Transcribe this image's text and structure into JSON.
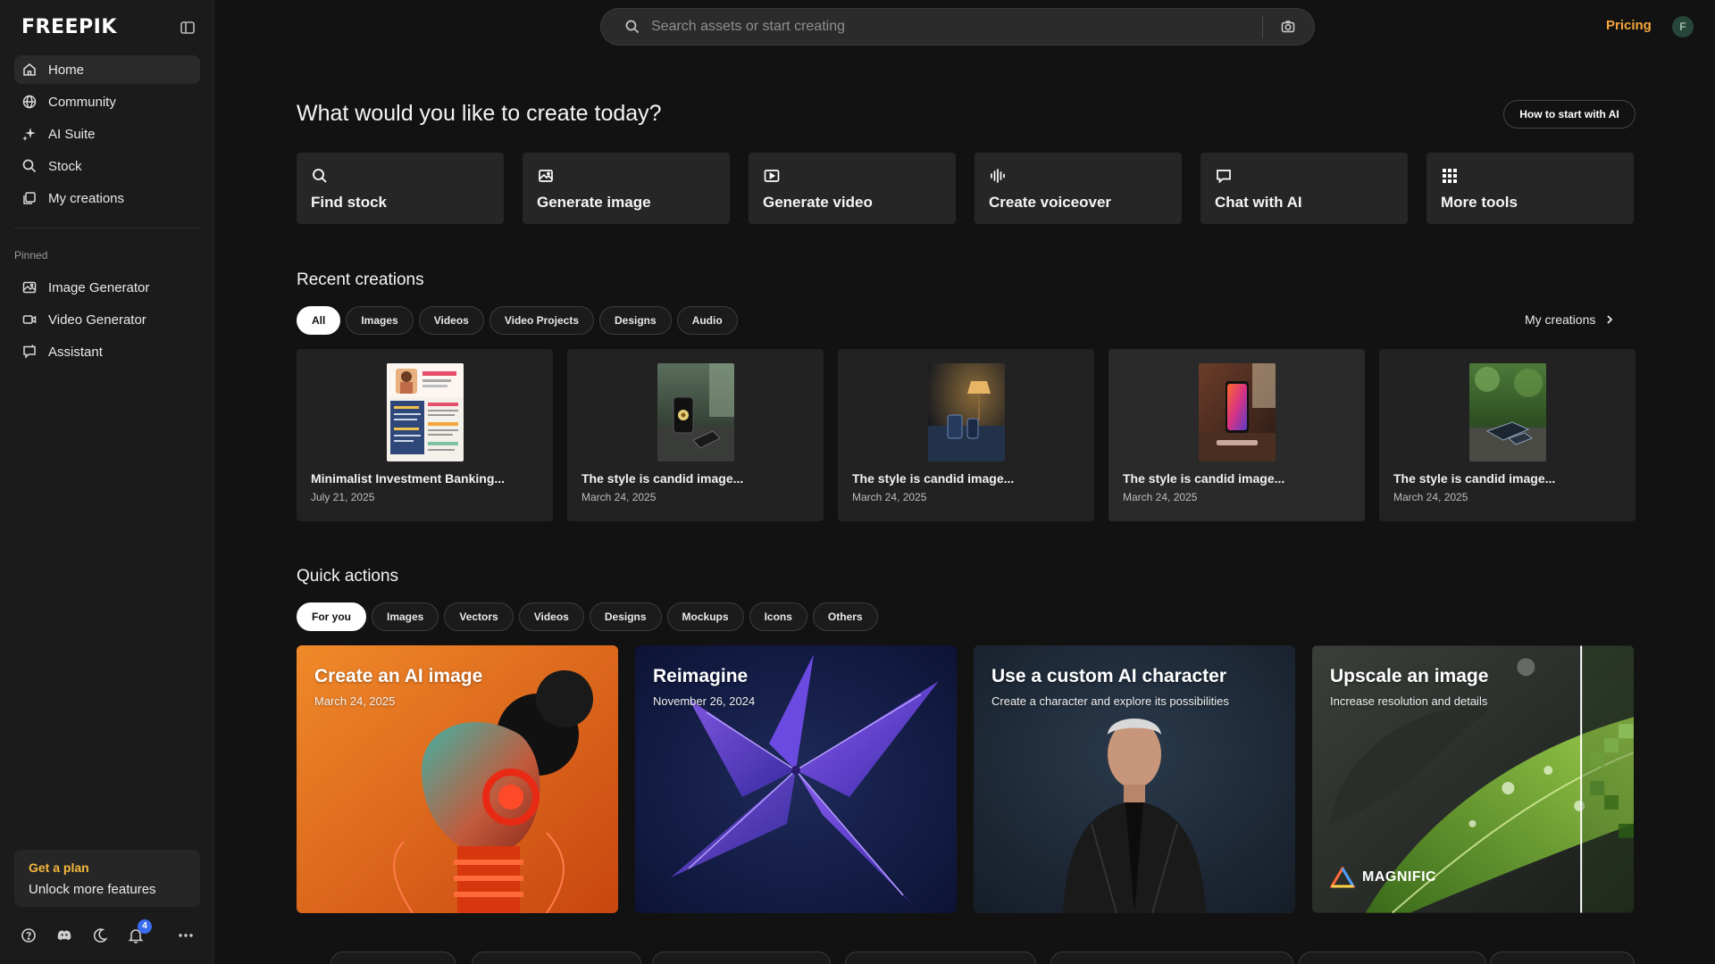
{
  "brand": {
    "logo": "FREEPIK"
  },
  "sidebar": {
    "nav": [
      {
        "label": "Home",
        "icon": "home-icon",
        "active": true
      },
      {
        "label": "Community",
        "icon": "globe-icon"
      },
      {
        "label": "AI Suite",
        "icon": "sparkle-icon"
      },
      {
        "label": "Stock",
        "icon": "search-icon"
      },
      {
        "label": "My creations",
        "icon": "creations-icon"
      }
    ],
    "pinned_label": "Pinned",
    "pinned": [
      {
        "label": "Image Generator",
        "icon": "image-generator-icon"
      },
      {
        "label": "Video Generator",
        "icon": "video-generator-icon"
      },
      {
        "label": "Assistant",
        "icon": "assistant-icon"
      }
    ],
    "plan": {
      "title": "Get a plan",
      "subtitle": "Unlock more features"
    },
    "notifications_count": "4"
  },
  "topbar": {
    "search_placeholder": "Search assets or start creating",
    "pricing": "Pricing",
    "avatar_initial": "F"
  },
  "main": {
    "heading": "What would you like to create today?",
    "how_to": "How to start with AI",
    "tools": [
      {
        "label": "Find stock",
        "icon": "search-icon"
      },
      {
        "label": "Generate image",
        "icon": "image-icon"
      },
      {
        "label": "Generate video",
        "icon": "video-icon"
      },
      {
        "label": "Create voiceover",
        "icon": "waveform-icon"
      },
      {
        "label": "Chat with AI",
        "icon": "chat-icon"
      },
      {
        "label": "More tools",
        "icon": "grid-icon"
      }
    ],
    "recent": {
      "title": "Recent creations",
      "filters": [
        "All",
        "Images",
        "Videos",
        "Video Projects",
        "Designs",
        "Audio"
      ],
      "active_filter": "All",
      "my_creations_link": "My creations",
      "items": [
        {
          "title": "Minimalist Investment Banking...",
          "date": "July 21, 2025"
        },
        {
          "title": "The style is candid image...",
          "date": "March 24, 2025"
        },
        {
          "title": "The style is candid image...",
          "date": "March 24, 2025"
        },
        {
          "title": "The style is candid image...",
          "date": "March 24, 2025"
        },
        {
          "title": "The style is candid image...",
          "date": "March 24, 2025"
        }
      ]
    },
    "quick": {
      "title": "Quick actions",
      "filters": [
        "For you",
        "Images",
        "Vectors",
        "Videos",
        "Designs",
        "Mockups",
        "Icons",
        "Others"
      ],
      "active_filter": "For you",
      "cards": [
        {
          "title": "Create an AI image",
          "subtitle": "March 24, 2025"
        },
        {
          "title": "Reimagine",
          "subtitle": "November 26, 2024"
        },
        {
          "title": "Use a custom AI character",
          "subtitle": "Create a character and explore its possibilities"
        },
        {
          "title": "Upscale an image",
          "subtitle": "Increase resolution and details",
          "brand": "MAGNIFIC"
        }
      ]
    }
  },
  "colors": {
    "background": "#121212",
    "sidebar": "#1b1b1b",
    "card": "#262626",
    "accent": "#f5a73b"
  }
}
